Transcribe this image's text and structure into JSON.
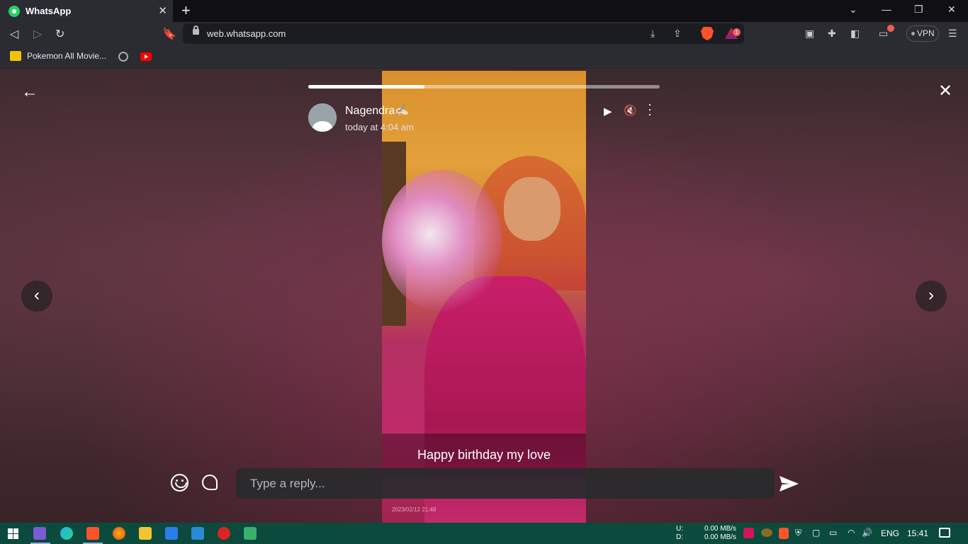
{
  "browser": {
    "tab_title": "WhatsApp",
    "tab_close": "✕",
    "new_tab": "+",
    "url": "web.whatsapp.com",
    "vpn_label": "VPN",
    "rewards_badge": "1",
    "bookmarks": [
      {
        "label": "Pokemon All Movie..."
      }
    ]
  },
  "status": {
    "contact_name": "Nagendra✍🏻",
    "timestamp": "today at 4:04 am",
    "caption": "Happy birthday my love",
    "progress_fraction": 0.33,
    "photo_date": "2023/02/12 21:48",
    "reply_placeholder": "Type a reply..."
  },
  "taskbar": {
    "net_up_label": "U:",
    "net_down_label": "D:",
    "net_up_value": "0.00 MB/s",
    "net_down_value": "0.00 MB/s",
    "language": "ENG",
    "time": "15:41"
  },
  "colors": {
    "whatsapp_green": "#25d366",
    "taskbar": "#0b4a3c",
    "brave_orange": "#fb542b"
  }
}
